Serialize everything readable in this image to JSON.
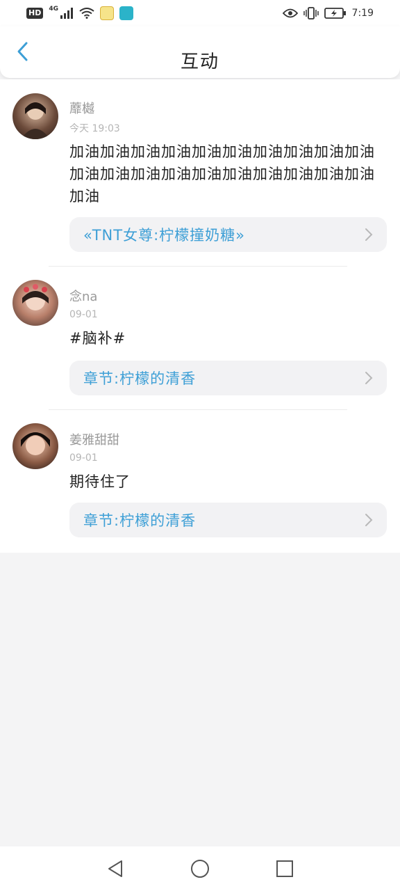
{
  "status_bar": {
    "hd_label": "HD",
    "network_label": "4G",
    "time": "7:19"
  },
  "header": {
    "title": "互动"
  },
  "comments": [
    {
      "username": "蘼樾",
      "time": "今天 19:03",
      "content": "加油加油加油加油加油加油加油加油加油加油加油加油加油加油加油加油加油加油加油加油加油",
      "link": "«TNT女尊:柠檬撞奶糖»"
    },
    {
      "username": "念na",
      "time": "09-01",
      "content": "#脑补#",
      "link": "章节:柠檬的清香"
    },
    {
      "username": "姜雅甜甜",
      "time": "09-01",
      "content": "期待住了",
      "link": "章节:柠檬的清香"
    }
  ],
  "colors": {
    "accent": "#3d9fd6",
    "background": "#f4f4f5",
    "card": "#f2f2f4"
  }
}
